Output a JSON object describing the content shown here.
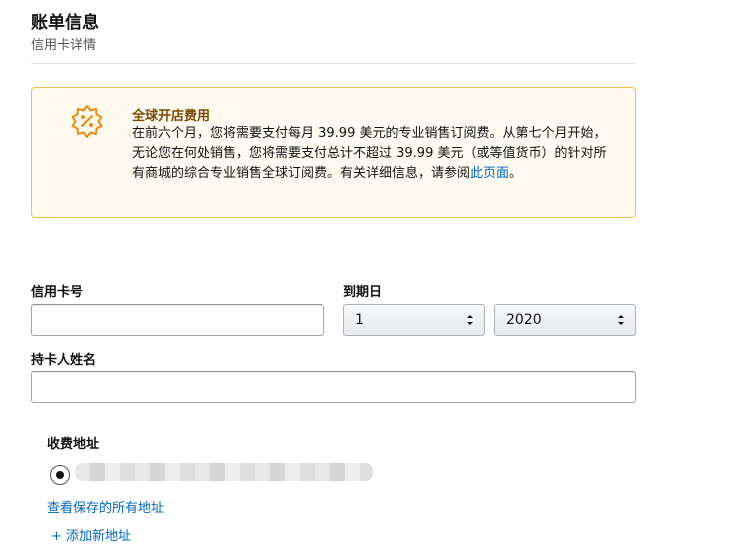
{
  "header": {
    "title": "账单信息",
    "subtitle": "信用卡详情"
  },
  "notice": {
    "icon": "badge-percent-icon",
    "title": "全球开店费用",
    "body": "在前六个月，您将需要支付每月 39.99 美元的专业销售订阅费。从第七个月开始，无论您在何处销售，您将需要支付总计不超过 39.99 美元（或等值货币）的针对所有商城的综合专业销售全球订阅费。有关详细信息，请参阅",
    "link_text": "此页面",
    "after_link": "。",
    "colors": {
      "border": "#f0c14b",
      "icon": "#e98b0e",
      "title": "#7a4a00",
      "link": "#0066c0"
    }
  },
  "form": {
    "card_number_label": "信用卡号",
    "card_number_value": "",
    "expiry_label": "到期日",
    "expiry_month": "1",
    "expiry_year": "2020",
    "cardholder_label": "持卡人姓名",
    "cardholder_value": ""
  },
  "billing": {
    "label": "收费地址",
    "selected_address": "",
    "view_all_link": "查看保存的所有地址",
    "add_new_link": "+ 添加新地址"
  }
}
